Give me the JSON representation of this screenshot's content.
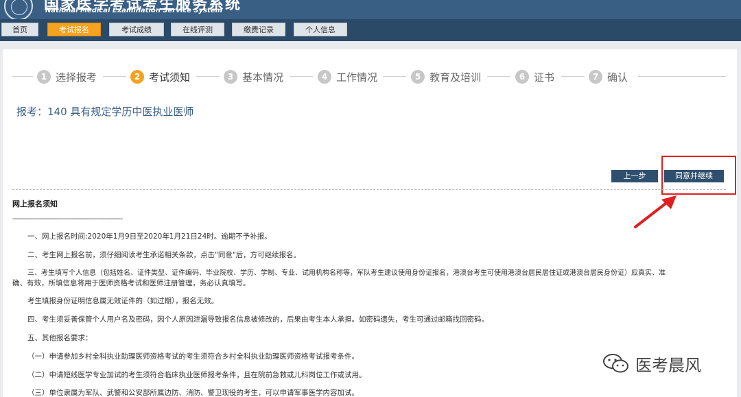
{
  "header": {
    "title_cn": "国家医学考试考生服务系统",
    "title_en": "National Medical Examination Service System"
  },
  "nav": {
    "items": [
      {
        "label": "首页"
      },
      {
        "label": "考试报名"
      },
      {
        "label": "考试成绩"
      },
      {
        "label": "在线评测"
      },
      {
        "label": "缴费记录"
      },
      {
        "label": "个人信息"
      }
    ]
  },
  "steps": [
    {
      "num": "1",
      "label": "选择报考"
    },
    {
      "num": "2",
      "label": "考试须知"
    },
    {
      "num": "3",
      "label": "基本情况"
    },
    {
      "num": "4",
      "label": "工作情况"
    },
    {
      "num": "5",
      "label": "教育及培训"
    },
    {
      "num": "6",
      "label": "证书"
    },
    {
      "num": "7",
      "label": "确认"
    }
  ],
  "exam": {
    "title": "报考：140 具有规定学历中医执业医师"
  },
  "buttons": {
    "prev": "上一步",
    "agree": "同意并继续"
  },
  "notice": {
    "title": "网上报名须知",
    "dashes": "------------------------------------------------------",
    "paragraphs": [
      "一、网上报名时间:2020年1月9日至2020年1月21日24时。逾期不予补报。",
      "二、考生网上报名前，须仔细阅读考生承诺相关条款，点击\"同意\"后，方可继续报名。",
      "三、考生填写个人信息（包括姓名、证件类型、证件编码、毕业院校、学历、学制、专业、试用机构名称等，军队考生建议使用身份证报名，港澳台考生可使用港澳台居民居住证或港澳台居民身份证）应真实、准",
      "确、有效，所填信息将用于医师资格考试和医师注册管理，务必认真填写。",
      "考生填报身份证明信息属无效证件的（如过期），报名无效。",
      "四、考生须妥善保管个人用户名及密码，因个人原因泄漏导致报名信息被修改的，后果由考生本人承担。如密码遗失，考生可通过邮箱找回密码。",
      "五、其他报名要求：",
      "（一）申请参加乡村全科执业助理医师资格考试的考生须符合乡村全科执业助理医师资格考试报考条件。",
      "（二）申请短线医学专业加试的考生须符合临床执业医师报考条件，且在院前急救或儿科岗位工作或试用。",
      "（三）单位隶属为军队、武警和公安部所属边防、消防、警卫现役的考生，可以申请军事医学内容加试。"
    ]
  },
  "watermark": {
    "text": "医考晨风"
  },
  "colors": {
    "header": "#3a5f85",
    "nav": "#2a4a68",
    "accent": "#f4a21f",
    "button": "#2f4f6e",
    "highlight": "#e02020"
  }
}
